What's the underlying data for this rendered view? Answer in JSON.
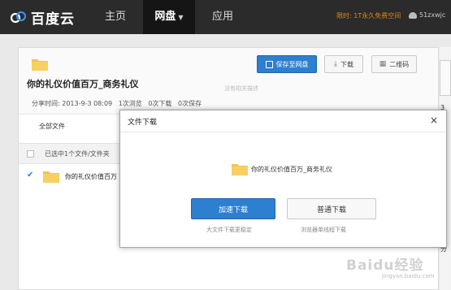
{
  "nav": {
    "logo_text": "百度云",
    "items": [
      "主页",
      "网盘",
      "应用"
    ],
    "caret": "▼",
    "promo": "限时: 1T永久免费空间",
    "username": "51zxwjc"
  },
  "share": {
    "title": "你的礼仪价值百万_商务礼仪",
    "meta": {
      "time_label": "分享时间: 2013-9-3 08:09",
      "views": "1次浏览",
      "downloads": "0次下载",
      "saves": "0次保存"
    },
    "no_desc": "没有相关描述",
    "buttons": {
      "save": "保存至网盘",
      "download": "下载",
      "qrcode": "二维码"
    },
    "all_files": "全部文件",
    "selected_text": "已选中1个文件/文件夹",
    "file_name": "你的礼仪价值百万"
  },
  "right_strip": {
    "num": "3",
    "text1": "6",
    "text2": "分"
  },
  "modal": {
    "title": "文件下载",
    "close": "×",
    "file_name": "你的礼仪价值百万_商务礼仪",
    "fast_button": "加速下载",
    "normal_button": "普通下载",
    "fast_hint": "大文件下载更稳定",
    "normal_hint": "浏览器单线程下载"
  },
  "watermark": {
    "main": "Baidu经验",
    "sub": "jingyan.baidu.com"
  },
  "colors": {
    "topbar": "#2b2b2b",
    "accent": "#2d7fd0",
    "promo": "#e0861e",
    "folder": "#f5c34d"
  }
}
